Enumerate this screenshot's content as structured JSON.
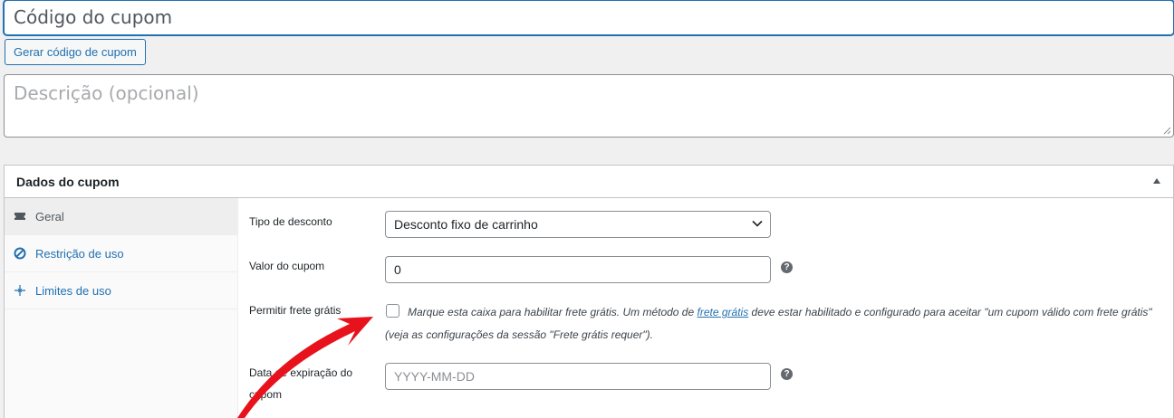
{
  "coupon": {
    "code_placeholder": "Código do cupom",
    "generate_button": "Gerar código de cupom",
    "description_placeholder": "Descrição (opcional)"
  },
  "coupon_data": {
    "title": "Dados do cupom",
    "tabs": [
      {
        "label": "Geral",
        "icon": "ticket-icon",
        "active": true
      },
      {
        "label": "Restrição de uso",
        "icon": "prohibited-icon",
        "active": false
      },
      {
        "label": "Limites de uso",
        "icon": "crosshair-icon",
        "active": false
      }
    ],
    "general": {
      "discount_type_label": "Tipo de desconto",
      "discount_type_value": "Desconto fixo de carrinho",
      "amount_label": "Valor do cupom",
      "amount_value": "0",
      "free_shipping_label": "Permitir frete grátis",
      "free_shipping_desc_before": "Marque esta caixa para habilitar frete grátis. Um método de ",
      "free_shipping_link": "frete grátis",
      "free_shipping_desc_after": " deve estar habilitado e configurado para aceitar \"um cupom válido com frete grátis\" (veja as configurações da sessão \"Frete grátis requer\").",
      "expiry_label_line1": "Data de expiração do",
      "expiry_label_line2": "cupom",
      "expiry_placeholder": "YYYY-MM-DD",
      "help_glyph": "?"
    }
  },
  "colors": {
    "accent": "#2271b1",
    "arrow": "#e8121c"
  }
}
